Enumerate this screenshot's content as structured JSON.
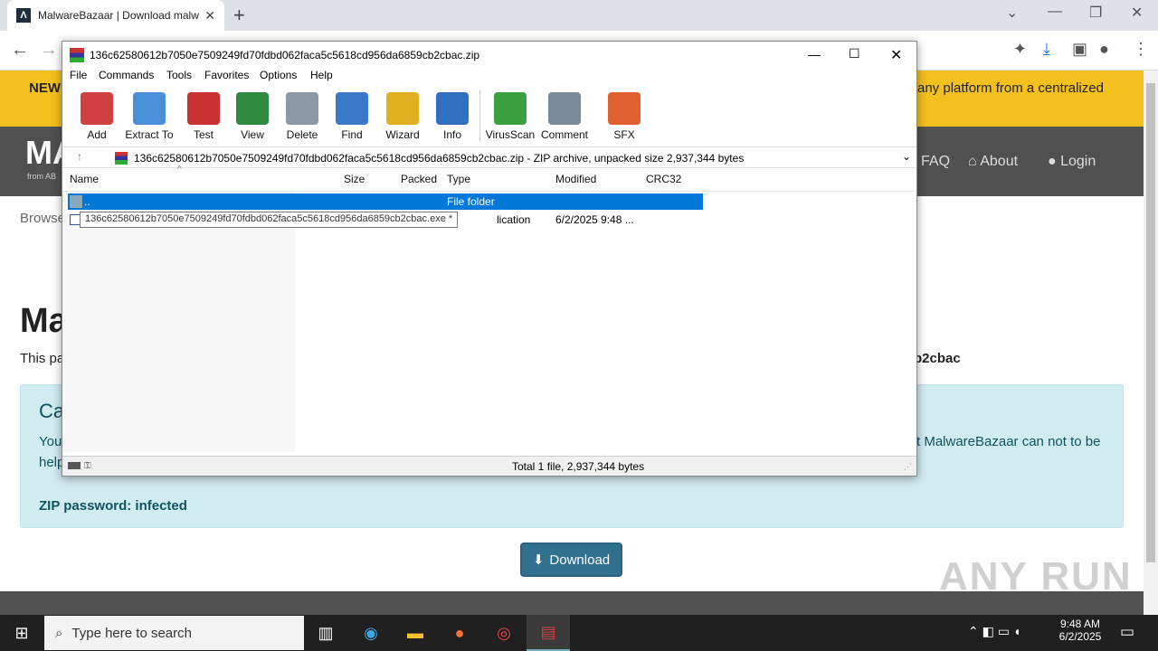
{
  "browser": {
    "tab_title": "MalwareBazaar | Download malw",
    "tab_favicon": "Λ"
  },
  "page": {
    "banner_left": "NEW",
    "banner_right": "any platform from a centralized",
    "logo_text": "MA",
    "logo_sub": "from AB",
    "nav_faq": "FAQ",
    "nav_about": "About",
    "nav_login": "Login",
    "browse": "Browse",
    "heading": "Ma",
    "intro_left": "This pa",
    "intro_right": "b2cbac",
    "alert_title": "Ca",
    "alert_line1_left": "You",
    "alert_line1_right": "t MalwareBazaar can not to be",
    "alert_line2_left": "help",
    "zip_password": "ZIP password: infected",
    "download_label": "Download"
  },
  "winrar": {
    "title": "136c62580612b7050e7509249fd70fdbd062faca5c5618cd956da6859cb2cbac.zip",
    "menu": [
      "File",
      "Commands",
      "Tools",
      "Favorites",
      "Options",
      "Help"
    ],
    "tools": [
      {
        "label": "Add",
        "color": "#d04040"
      },
      {
        "label": "Extract To",
        "color": "#4a90d9"
      },
      {
        "label": "Test",
        "color": "#c83232"
      },
      {
        "label": "View",
        "color": "#2e8b3e"
      },
      {
        "label": "Delete",
        "color": "#8a98a8"
      },
      {
        "label": "Find",
        "color": "#3a78c8"
      },
      {
        "label": "Wizard",
        "color": "#e0b020"
      },
      {
        "label": "Info",
        "color": "#2f6fc0"
      },
      {
        "label": "VirusScan",
        "color": "#3aa040"
      },
      {
        "label": "Comment",
        "color": "#7a8a9a"
      },
      {
        "label": "SFX",
        "color": "#e06030"
      }
    ],
    "address": "136c62580612b7050e7509249fd70fdbd062faca5c5618cd956da6859cb2cbac.zip - ZIP archive, unpacked size 2,937,344 bytes",
    "columns": [
      "Name",
      "Size",
      "Packed",
      "Type",
      "Modified",
      "CRC32"
    ],
    "rows": [
      {
        "name": "..",
        "type": "File folder",
        "modified": ""
      },
      {
        "name": "",
        "type": "lication",
        "modified": "6/2/2025 9:48 ..."
      }
    ],
    "tooltip": "136c62580612b7050e7509249fd70fdbd062faca5c5618cd956da6859cb2cbac.exe *",
    "status": "Total 1 file, 2,937,344 bytes"
  },
  "taskbar": {
    "search_placeholder": "Type here to search",
    "time": "9:48 AM",
    "date": "6/2/2025"
  },
  "watermark": "ANY RUN"
}
